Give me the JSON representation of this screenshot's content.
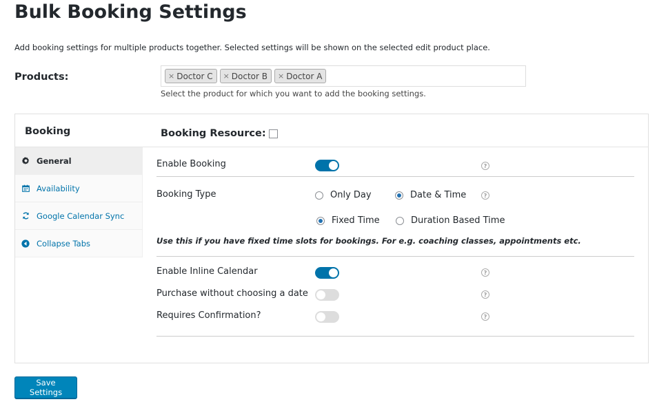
{
  "page": {
    "title": "Bulk Booking Settings",
    "description": "Add booking settings for multiple products together. Selected settings will be shown on the selected edit product place."
  },
  "products": {
    "label": "Products:",
    "selected": [
      "Doctor C",
      "Doctor B",
      "Doctor A"
    ],
    "remove_glyph": "×",
    "help": "Select the product for which you want to add the booking settings."
  },
  "panel": {
    "title": "Booking",
    "resource_label": "Booking Resource:",
    "resource_checked": false
  },
  "tabs": [
    {
      "label": "General",
      "icon": "gear-icon",
      "active": true
    },
    {
      "label": "Availability",
      "icon": "calendar-icon",
      "active": false
    },
    {
      "label": "Google Calendar Sync",
      "icon": "sync-icon",
      "active": false
    },
    {
      "label": "Collapse Tabs",
      "icon": "collapse-icon",
      "active": false
    }
  ],
  "general": {
    "enable_booking": {
      "label": "Enable Booking",
      "on": true
    },
    "booking_type": {
      "label": "Booking Type",
      "options_row1": [
        {
          "label": "Only Day",
          "checked": false
        },
        {
          "label": "Date & Time",
          "checked": true
        }
      ],
      "options_row2": [
        {
          "label": "Fixed Time",
          "checked": true
        },
        {
          "label": "Duration Based Time",
          "checked": false
        }
      ],
      "note": "Use this if you have fixed time slots for bookings. For e.g. coaching classes, appointments etc."
    },
    "enable_inline_calendar": {
      "label": "Enable Inline Calendar",
      "on": true
    },
    "purchase_without_date": {
      "label": "Purchase without choosing a date",
      "on": false
    },
    "requires_confirmation": {
      "label": "Requires Confirmation?",
      "on": false
    },
    "help_glyph": "?"
  },
  "actions": {
    "save_label": "Save Settings"
  },
  "colors": {
    "accent": "#0073aa",
    "button": "#0085ba",
    "toggle_off": "#dddddd"
  }
}
